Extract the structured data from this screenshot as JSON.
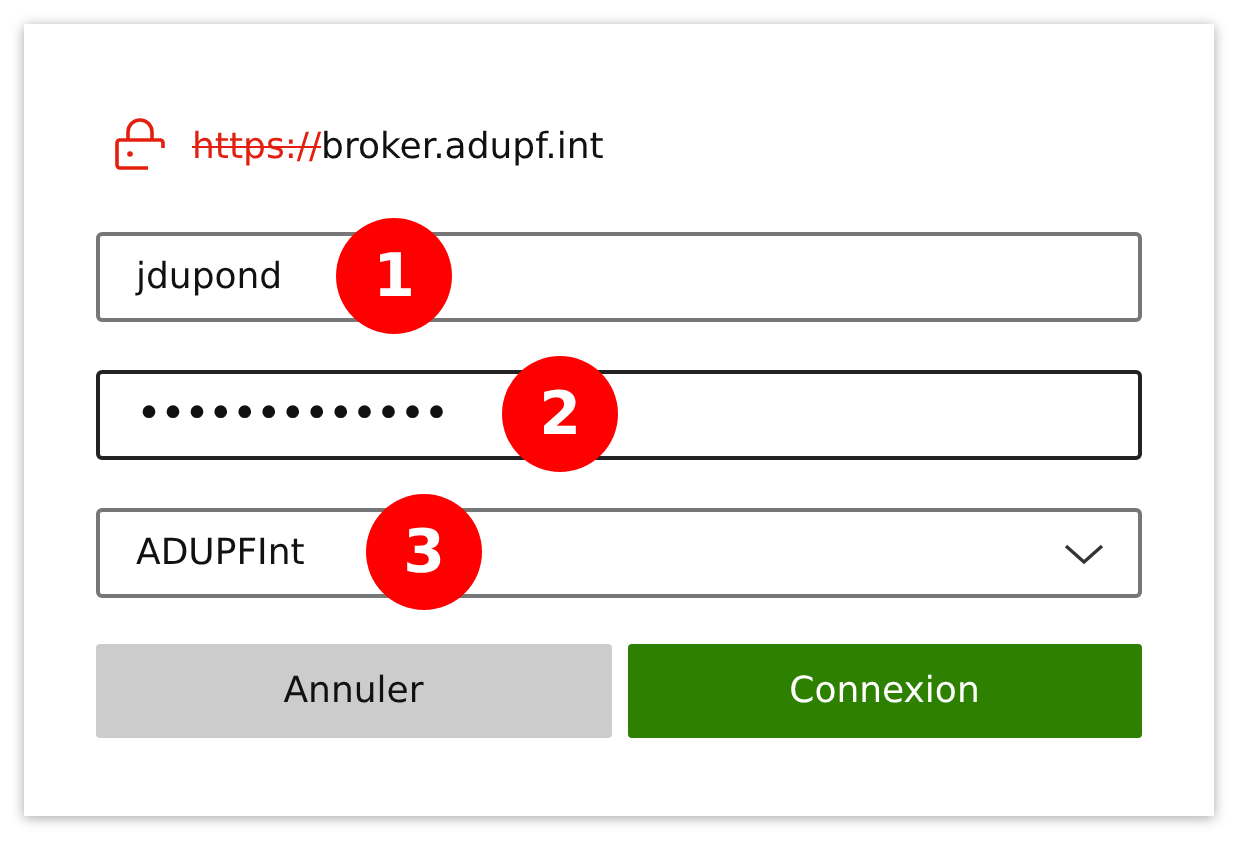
{
  "address": {
    "scheme": "https://",
    "host": "broker.adupf.int",
    "secure": false
  },
  "fields": [
    {
      "kind": "text",
      "value": "jdupond",
      "focused": false,
      "badge": "1"
    },
    {
      "kind": "password",
      "value": "•••••••••••••",
      "focused": true,
      "badge": "2"
    },
    {
      "kind": "dropdown",
      "value": "ADUPFInt",
      "focused": false,
      "badge": "3"
    }
  ],
  "buttons": [
    {
      "label": "Annuler",
      "kind": "secondary"
    },
    {
      "label": "Connexion",
      "kind": "primary"
    }
  ]
}
